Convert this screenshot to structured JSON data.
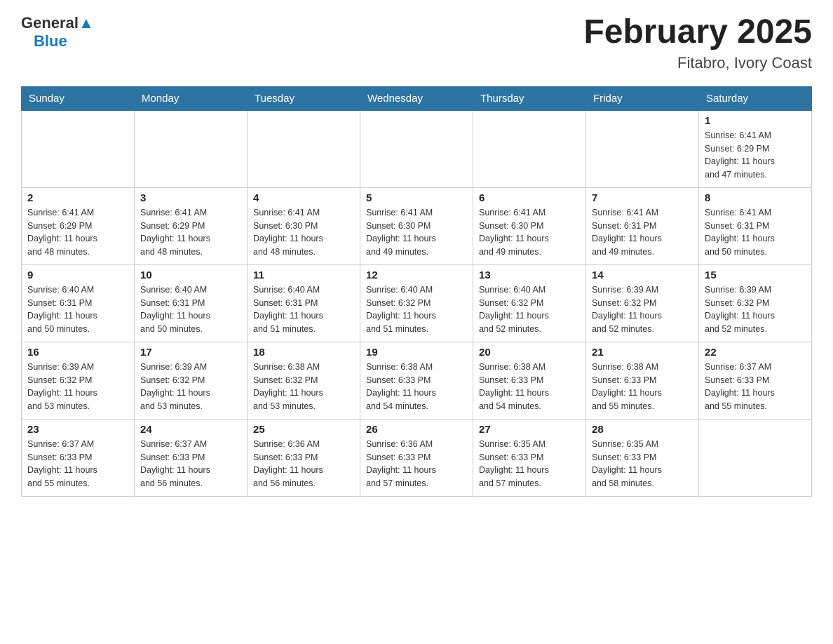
{
  "header": {
    "logo_general": "General",
    "logo_blue": "Blue",
    "month_year": "February 2025",
    "location": "Fitabro, Ivory Coast"
  },
  "days_of_week": [
    "Sunday",
    "Monday",
    "Tuesday",
    "Wednesday",
    "Thursday",
    "Friday",
    "Saturday"
  ],
  "weeks": [
    {
      "days": [
        {
          "num": "",
          "info": ""
        },
        {
          "num": "",
          "info": ""
        },
        {
          "num": "",
          "info": ""
        },
        {
          "num": "",
          "info": ""
        },
        {
          "num": "",
          "info": ""
        },
        {
          "num": "",
          "info": ""
        },
        {
          "num": "1",
          "info": "Sunrise: 6:41 AM\nSunset: 6:29 PM\nDaylight: 11 hours\nand 47 minutes."
        }
      ]
    },
    {
      "days": [
        {
          "num": "2",
          "info": "Sunrise: 6:41 AM\nSunset: 6:29 PM\nDaylight: 11 hours\nand 48 minutes."
        },
        {
          "num": "3",
          "info": "Sunrise: 6:41 AM\nSunset: 6:29 PM\nDaylight: 11 hours\nand 48 minutes."
        },
        {
          "num": "4",
          "info": "Sunrise: 6:41 AM\nSunset: 6:30 PM\nDaylight: 11 hours\nand 48 minutes."
        },
        {
          "num": "5",
          "info": "Sunrise: 6:41 AM\nSunset: 6:30 PM\nDaylight: 11 hours\nand 49 minutes."
        },
        {
          "num": "6",
          "info": "Sunrise: 6:41 AM\nSunset: 6:30 PM\nDaylight: 11 hours\nand 49 minutes."
        },
        {
          "num": "7",
          "info": "Sunrise: 6:41 AM\nSunset: 6:31 PM\nDaylight: 11 hours\nand 49 minutes."
        },
        {
          "num": "8",
          "info": "Sunrise: 6:41 AM\nSunset: 6:31 PM\nDaylight: 11 hours\nand 50 minutes."
        }
      ]
    },
    {
      "days": [
        {
          "num": "9",
          "info": "Sunrise: 6:40 AM\nSunset: 6:31 PM\nDaylight: 11 hours\nand 50 minutes."
        },
        {
          "num": "10",
          "info": "Sunrise: 6:40 AM\nSunset: 6:31 PM\nDaylight: 11 hours\nand 50 minutes."
        },
        {
          "num": "11",
          "info": "Sunrise: 6:40 AM\nSunset: 6:31 PM\nDaylight: 11 hours\nand 51 minutes."
        },
        {
          "num": "12",
          "info": "Sunrise: 6:40 AM\nSunset: 6:32 PM\nDaylight: 11 hours\nand 51 minutes."
        },
        {
          "num": "13",
          "info": "Sunrise: 6:40 AM\nSunset: 6:32 PM\nDaylight: 11 hours\nand 52 minutes."
        },
        {
          "num": "14",
          "info": "Sunrise: 6:39 AM\nSunset: 6:32 PM\nDaylight: 11 hours\nand 52 minutes."
        },
        {
          "num": "15",
          "info": "Sunrise: 6:39 AM\nSunset: 6:32 PM\nDaylight: 11 hours\nand 52 minutes."
        }
      ]
    },
    {
      "days": [
        {
          "num": "16",
          "info": "Sunrise: 6:39 AM\nSunset: 6:32 PM\nDaylight: 11 hours\nand 53 minutes."
        },
        {
          "num": "17",
          "info": "Sunrise: 6:39 AM\nSunset: 6:32 PM\nDaylight: 11 hours\nand 53 minutes."
        },
        {
          "num": "18",
          "info": "Sunrise: 6:38 AM\nSunset: 6:32 PM\nDaylight: 11 hours\nand 53 minutes."
        },
        {
          "num": "19",
          "info": "Sunrise: 6:38 AM\nSunset: 6:33 PM\nDaylight: 11 hours\nand 54 minutes."
        },
        {
          "num": "20",
          "info": "Sunrise: 6:38 AM\nSunset: 6:33 PM\nDaylight: 11 hours\nand 54 minutes."
        },
        {
          "num": "21",
          "info": "Sunrise: 6:38 AM\nSunset: 6:33 PM\nDaylight: 11 hours\nand 55 minutes."
        },
        {
          "num": "22",
          "info": "Sunrise: 6:37 AM\nSunset: 6:33 PM\nDaylight: 11 hours\nand 55 minutes."
        }
      ]
    },
    {
      "days": [
        {
          "num": "23",
          "info": "Sunrise: 6:37 AM\nSunset: 6:33 PM\nDaylight: 11 hours\nand 55 minutes."
        },
        {
          "num": "24",
          "info": "Sunrise: 6:37 AM\nSunset: 6:33 PM\nDaylight: 11 hours\nand 56 minutes."
        },
        {
          "num": "25",
          "info": "Sunrise: 6:36 AM\nSunset: 6:33 PM\nDaylight: 11 hours\nand 56 minutes."
        },
        {
          "num": "26",
          "info": "Sunrise: 6:36 AM\nSunset: 6:33 PM\nDaylight: 11 hours\nand 57 minutes."
        },
        {
          "num": "27",
          "info": "Sunrise: 6:35 AM\nSunset: 6:33 PM\nDaylight: 11 hours\nand 57 minutes."
        },
        {
          "num": "28",
          "info": "Sunrise: 6:35 AM\nSunset: 6:33 PM\nDaylight: 11 hours\nand 58 minutes."
        },
        {
          "num": "",
          "info": ""
        }
      ]
    }
  ]
}
